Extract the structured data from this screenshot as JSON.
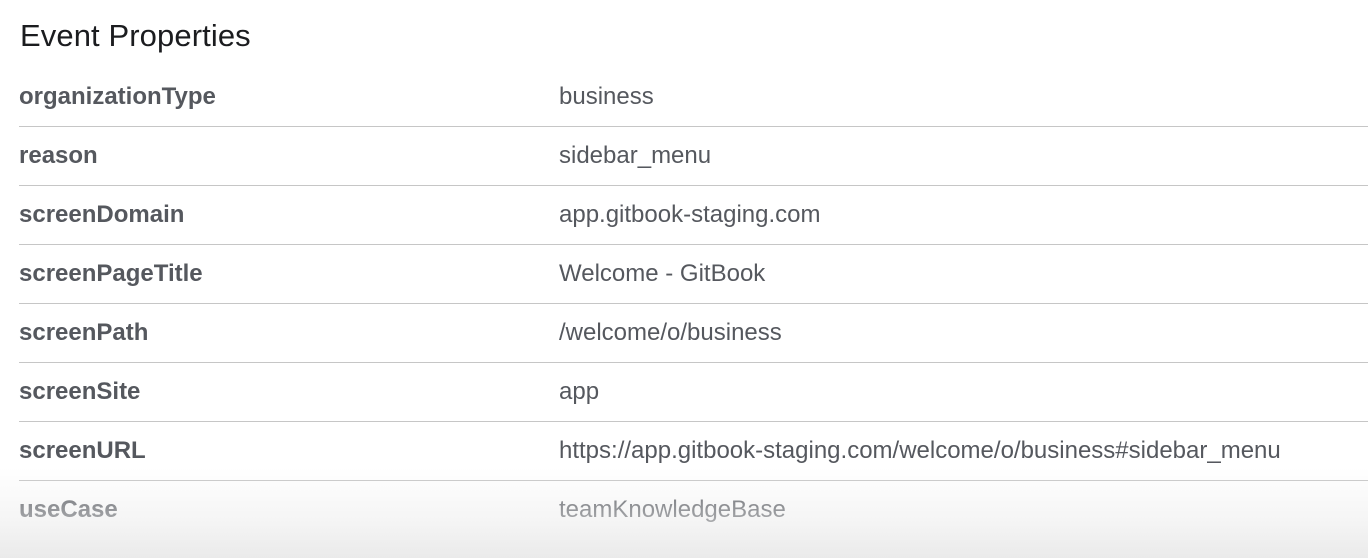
{
  "panel": {
    "title": "Event Properties",
    "properties": [
      {
        "key": "organizationType",
        "value": "business"
      },
      {
        "key": "reason",
        "value": "sidebar_menu"
      },
      {
        "key": "screenDomain",
        "value": "app.gitbook-staging.com"
      },
      {
        "key": "screenPageTitle",
        "value": "Welcome - GitBook"
      },
      {
        "key": "screenPath",
        "value": "/welcome/o/business"
      },
      {
        "key": "screenSite",
        "value": "app"
      },
      {
        "key": "screenURL",
        "value": "https://app.gitbook-staging.com/welcome/o/business#sidebar_menu"
      },
      {
        "key": "useCase",
        "value": "teamKnowledgeBase"
      }
    ]
  },
  "colors": {
    "title_text": "#1b1c1f",
    "body_text": "#55585e",
    "divider": "#c6c6c6",
    "background": "#ffffff"
  }
}
